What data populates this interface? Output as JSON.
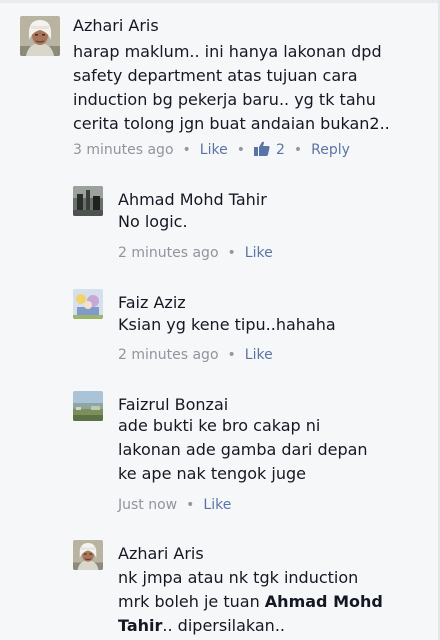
{
  "colors": {
    "background": "#f6f7f9",
    "name_text": "#141823",
    "meta_text": "#90949c",
    "link_blue": "#5b74a8"
  },
  "comments": [
    {
      "author": "Azhari Aris",
      "text": "harap maklum.. ini hanya lakonan dpd\nsafety department atas tujuan cara\ninduction bg pekerja baru.. yg tk tahu\ncerita tolong jgn buat andaian bukan2..",
      "time": "3 minutes ago",
      "like_label": "Like",
      "like_count": "2",
      "reply_label": "Reply",
      "avatar_icon": "man-with-white-headscarf-avatar"
    },
    {
      "author": "Ahmad Mohd Tahir",
      "text": "No logic.",
      "time": "2 minutes ago",
      "like_label": "Like",
      "avatar_icon": "photo-avatar"
    },
    {
      "author": "Faiz Aziz",
      "text": "Ksian yg kene tipu..hahaha",
      "time": "2 minutes ago",
      "like_label": "Like",
      "avatar_icon": "cartoon-avatar"
    },
    {
      "author": "Faizrul Bonzai",
      "text": "ade bukti ke bro cakap ni\nlakonan ade gamba dari depan\nke ape nak tengok juge",
      "time": "Just now",
      "like_label": "Like",
      "avatar_icon": "landscape-avatar"
    },
    {
      "author": "Azhari Aris",
      "text_before": "nk jmpa atau nk tgk induction\nmrk boleh je tuan ",
      "mention": "Ahmad Mohd\nTahir",
      "text_after": ".. dipersilakan..",
      "avatar_icon": "man-with-white-headscarf-avatar"
    }
  ]
}
